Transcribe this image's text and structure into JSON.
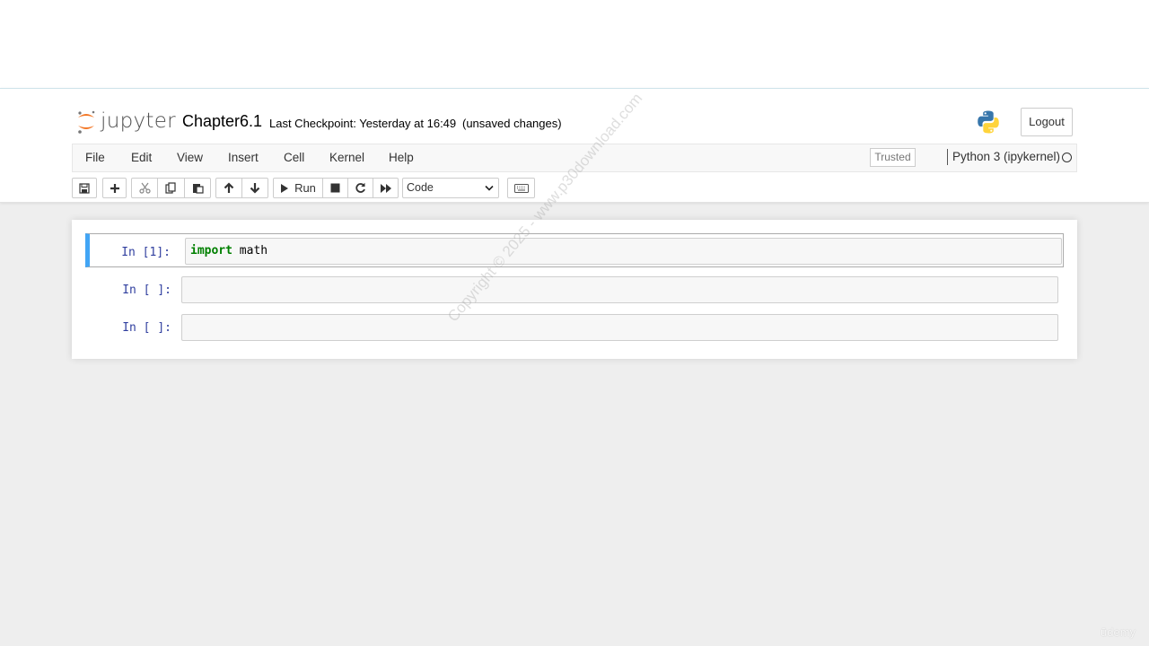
{
  "header": {
    "logo_text": "jupyter",
    "notebook_name": "Chapter6.1",
    "checkpoint": "Last Checkpoint: Yesterday at 16:49",
    "autosave_status": "(unsaved changes)",
    "logout_label": "Logout"
  },
  "menubar": {
    "items": [
      "File",
      "Edit",
      "View",
      "Insert",
      "Cell",
      "Kernel",
      "Help"
    ],
    "trusted_label": "Trusted",
    "kernel_name": "Python 3 (ipykernel)"
  },
  "toolbar": {
    "buttons": [
      "save-icon",
      "plus-icon",
      "scissors-icon",
      "copy-icon",
      "paste-icon",
      "arrow-up-icon",
      "arrow-down-icon",
      "play-icon",
      "stop-icon",
      "restart-icon",
      "fast-forward-icon",
      "keyboard-icon"
    ],
    "run_label": "Run",
    "cell_type": "Code"
  },
  "cells": [
    {
      "prompt": "In [1]:",
      "keyword": "import",
      "code_rest": " math",
      "selected": true
    },
    {
      "prompt": "In [ ]:",
      "keyword": "",
      "code_rest": "",
      "selected": false
    },
    {
      "prompt": "In [ ]:",
      "keyword": "",
      "code_rest": "",
      "selected": false
    }
  ],
  "watermark": "Copyright © 2025 - www.p30download.com",
  "corner_brand": "ūdemy",
  "colors": {
    "accent_selected_cell": "#42a5f5",
    "prompt_blue": "#303f9f",
    "keyword_green": "#008000",
    "jupyter_orange": "#f37726"
  }
}
